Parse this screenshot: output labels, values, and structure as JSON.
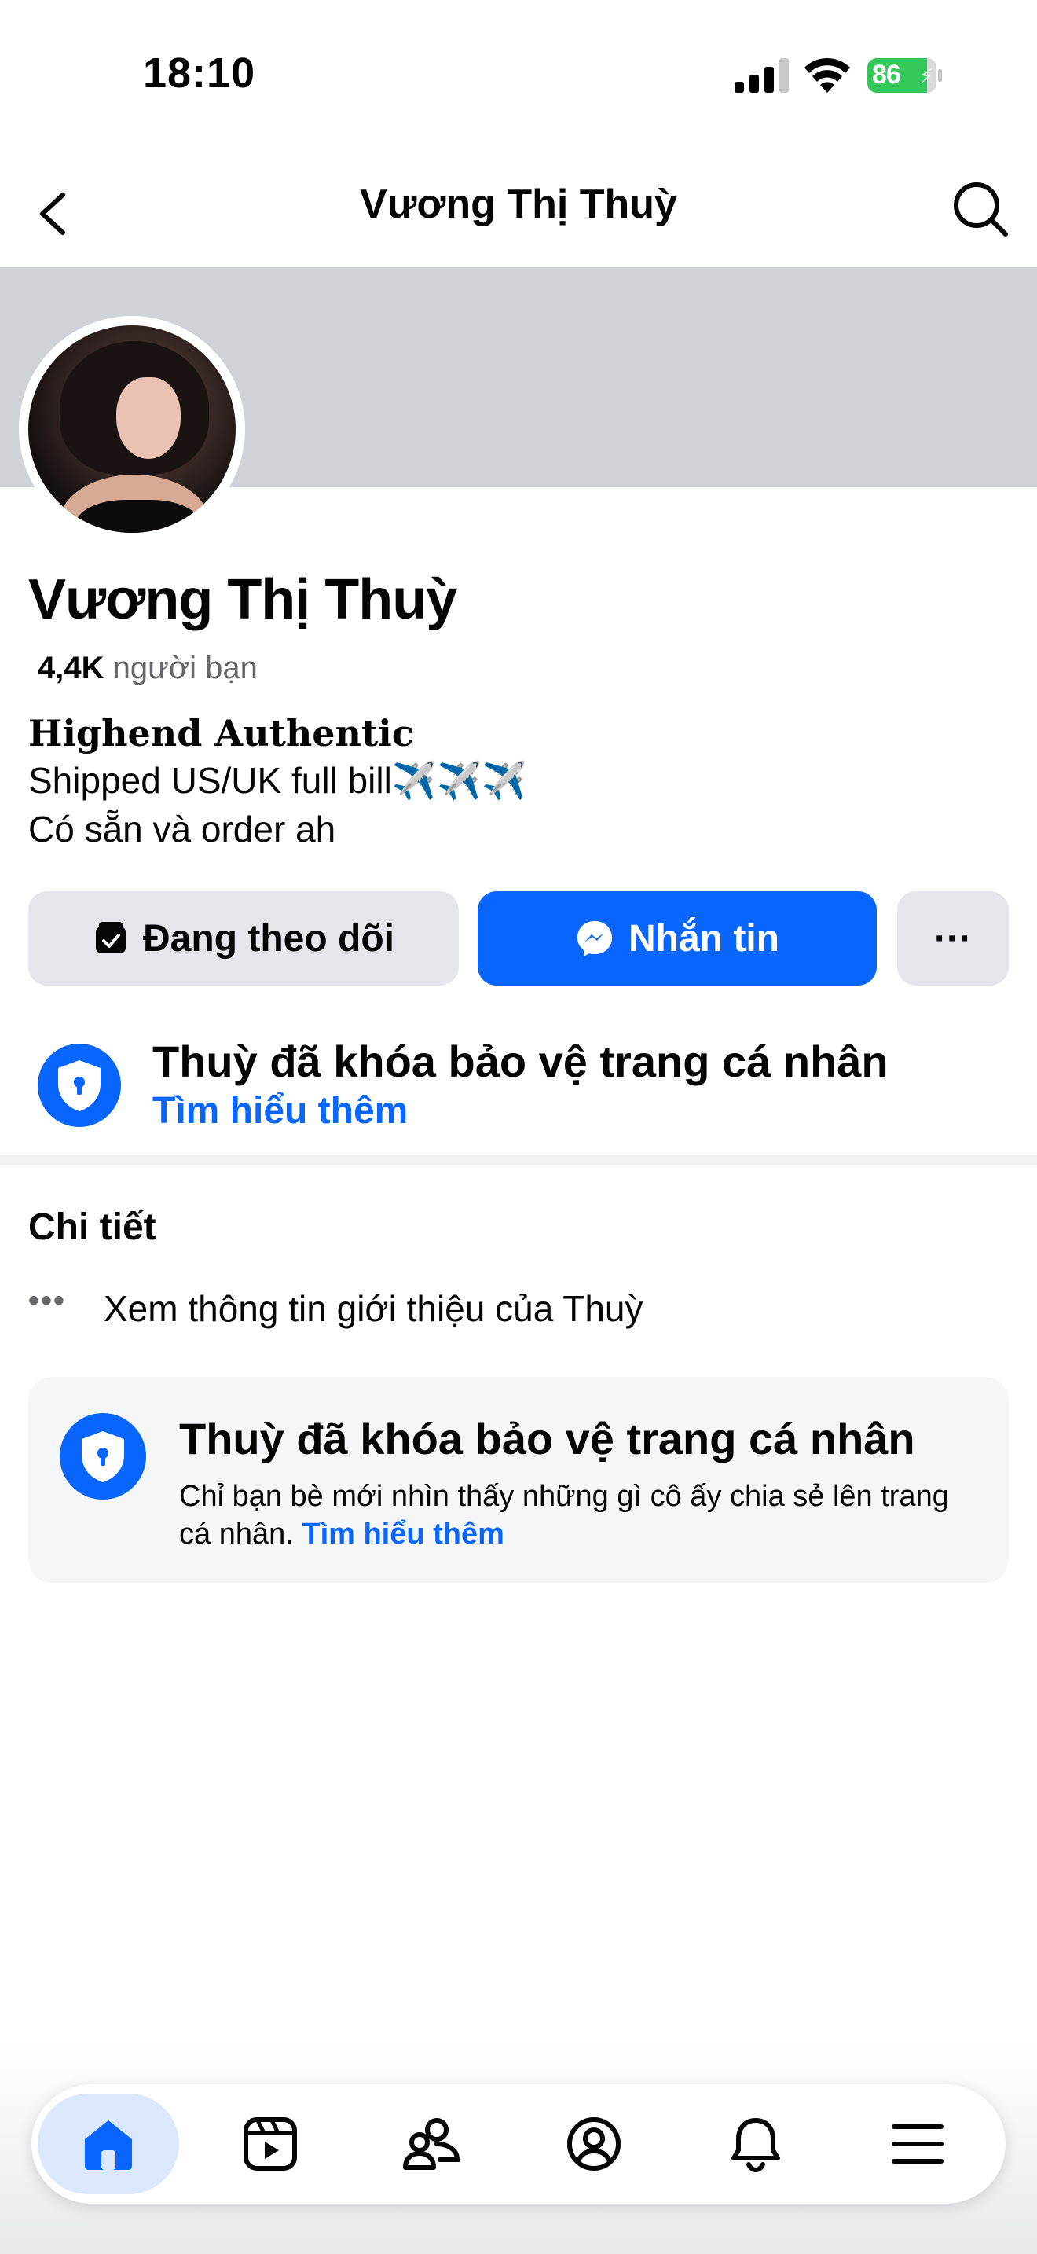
{
  "status_bar": {
    "time": "18:10",
    "battery": "86",
    "battery_level": 0.86
  },
  "nav": {
    "title": "Vương Thị Thuỳ",
    "back_icon": "chevron-left-icon",
    "search_icon": "search-icon"
  },
  "profile": {
    "name": "Vương Thị Thuỳ",
    "friends_count": "4,4K",
    "friends_label": "người bạn",
    "bio": {
      "title": "𝐇𝐢𝐠𝐡𝐞𝐧𝐝 𝐀𝐮𝐭𝐡𝐞𝐧𝐭𝐢𝐜",
      "line1": "Shipped US/UK full bill",
      "line1_emoji": "✈️✈️✈️",
      "line2": "Có sẵn và order ah"
    }
  },
  "actions": {
    "follow": "Đang theo dõi",
    "message": "Nhắn tin",
    "more": "···"
  },
  "lock_notice": {
    "title": "Thuỳ đã khóa bảo vệ trang cá nhân",
    "link": "Tìm hiểu thêm"
  },
  "details": {
    "title": "Chi tiết",
    "about": "Xem thông tin giới thiệu của Thuỳ",
    "dots": "•••"
  },
  "info_card": {
    "title": "Thuỳ đã khóa bảo vệ trang cá nhân",
    "text": "Chỉ bạn bè mới nhìn thấy những gì cô ấy chia sẻ lên trang cá nhân.",
    "link": "Tìm hiểu thêm"
  },
  "tab_bar": {
    "tabs": [
      {
        "name": "home",
        "icon": "home-icon",
        "active": true
      },
      {
        "name": "video",
        "icon": "video-icon",
        "active": false
      },
      {
        "name": "friends",
        "icon": "friends-icon",
        "active": false
      },
      {
        "name": "profile",
        "icon": "profile-icon",
        "active": false
      },
      {
        "name": "notifications",
        "icon": "bell-icon",
        "active": false
      },
      {
        "name": "menu",
        "icon": "menu-icon",
        "active": false
      }
    ]
  },
  "colors": {
    "accent": "#0866ff",
    "cover": "#cfd3d8",
    "button_gray": "#e4e6eb",
    "battery_green": "#34c759"
  }
}
